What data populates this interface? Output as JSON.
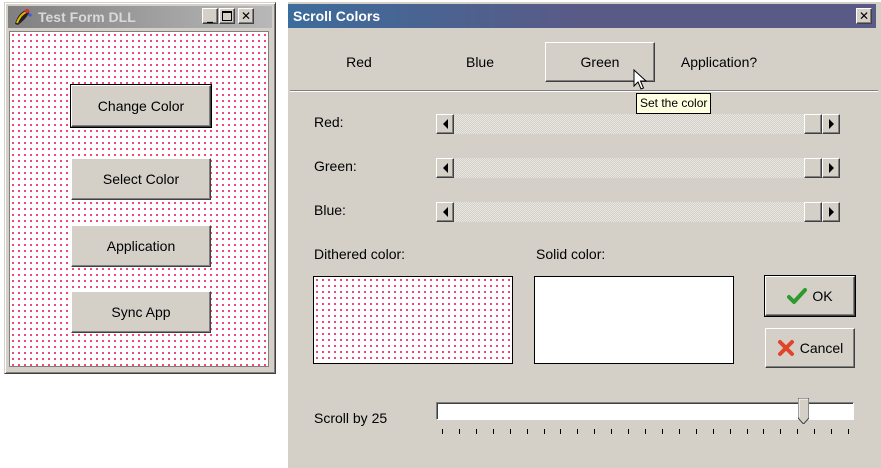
{
  "left_window": {
    "title": "Test Form DLL",
    "buttons": [
      "Change Color",
      "Select Color",
      "Application",
      "Sync App"
    ]
  },
  "right_window": {
    "title": "Scroll Colors",
    "toolbar": [
      "Red",
      "Blue",
      "Green",
      "Application?"
    ],
    "tooltip": "Set the color",
    "red_label": "Red:",
    "green_label": "Green:",
    "blue_label": "Blue:",
    "dithered_label": "Dithered color:",
    "solid_label": "Solid color:",
    "ok_label": "OK",
    "cancel_label": "Cancel",
    "scroll_label": "Scroll by 25",
    "scrollbar_values": {
      "red": 1.0,
      "green": 1.0,
      "blue": 1.0
    },
    "trackbar_value": 0.89
  },
  "colors": {
    "dither_dot": "#ee2b6a",
    "active_title": "#5a5a86",
    "face": "#d4d0c8",
    "ok_check": "#2e9a2e",
    "cancel_x": "#e0442a"
  },
  "icons": [
    "app-icon",
    "minimize-icon",
    "maximize-icon",
    "close-icon",
    "checkmark-icon",
    "x-mark-icon",
    "pointer-cursor-icon",
    "left-arrow-icon",
    "right-arrow-icon"
  ]
}
